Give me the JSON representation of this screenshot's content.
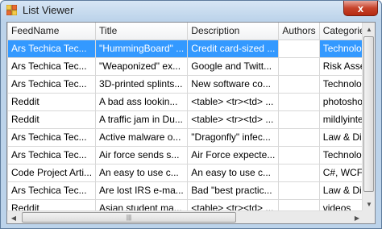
{
  "window": {
    "title": "List Viewer",
    "close_label": "x"
  },
  "table": {
    "columns": [
      "FeedName",
      "Title",
      "Description",
      "Authors",
      "Categories"
    ],
    "rows": [
      [
        "Ars Techica Tec...",
        "\"HummingBoard\" ...",
        "Credit card-sized ...",
        "",
        "Technology L"
      ],
      [
        "Ars Techica Tec...",
        "\"Weaponized\" ex...",
        "Google and Twitt...",
        "",
        "Risk Assessm"
      ],
      [
        "Ars Techica Tec...",
        "3D-printed splints...",
        "New software co...",
        "",
        "Technology L"
      ],
      [
        "Reddit",
        "A bad ass lookin...",
        "<table> <tr><td> ...",
        "",
        "photoshopbat"
      ],
      [
        "Reddit",
        "A traffic jam in Du...",
        "<table> <tr><td> ...",
        "",
        "mildlyinteresti"
      ],
      [
        "Ars Techica Tec...",
        "Active malware o...",
        "\"Dragonfly\" infec...",
        "",
        "Law & Disord"
      ],
      [
        "Ars Techica Tec...",
        "Air force sends s...",
        "Air Force expecte...",
        "",
        "Technology L"
      ],
      [
        "Code Project Arti...",
        "An easy to use c...",
        "An easy to use c...",
        "",
        "C#, WCF, WP"
      ],
      [
        "Ars Techica Tec...",
        "Are lost IRS e-ma...",
        "Bad \"best practic...",
        "",
        "Law & Disord"
      ],
      [
        "Reddit",
        "Asian student ma...",
        "<table> <tr><td> ...",
        "",
        "videos"
      ]
    ],
    "selected_row": 0
  },
  "scrollbars": {
    "up_arrow": "▲",
    "down_arrow": "▼",
    "left_arrow": "◀",
    "right_arrow": "▶",
    "grip": "|||"
  }
}
